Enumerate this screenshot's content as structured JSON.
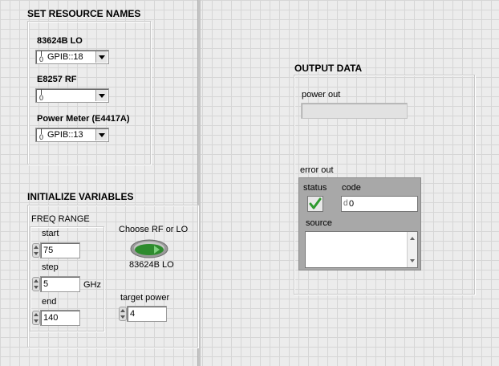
{
  "resources": {
    "heading": "SET RESOURCE NAMES",
    "lo_label": "83624B LO",
    "lo_value": "GPIB::18",
    "rf_label": "E8257 RF",
    "rf_value": "",
    "pm_label": "Power Meter (E4417A)",
    "pm_value": "GPIB::13",
    "io_glyph": "I/O"
  },
  "init": {
    "heading": "INITIALIZE VARIABLES",
    "freq_range_label": "FREQ RANGE",
    "start_label": "start",
    "start_value": "75",
    "step_label": "step",
    "step_value": "5",
    "step_unit": "GHz",
    "end_label": "end",
    "end_value": "140",
    "choose_label": "Choose RF or LO",
    "choose_state": "83624B LO",
    "target_power_label": "target power",
    "target_power_value": "4"
  },
  "output": {
    "heading": "OUTPUT DATA",
    "power_out_label": "power out",
    "power_out_value": "",
    "error_out_label": "error out",
    "status_label": "status",
    "status_checked": true,
    "code_label": "code",
    "code_prefix": "d",
    "code_value": "0",
    "source_label": "source",
    "source_value": ""
  },
  "colors": {
    "background": "#ececec",
    "toggle_green": "#2e8b2e",
    "check_green": "#2f9a2f"
  }
}
